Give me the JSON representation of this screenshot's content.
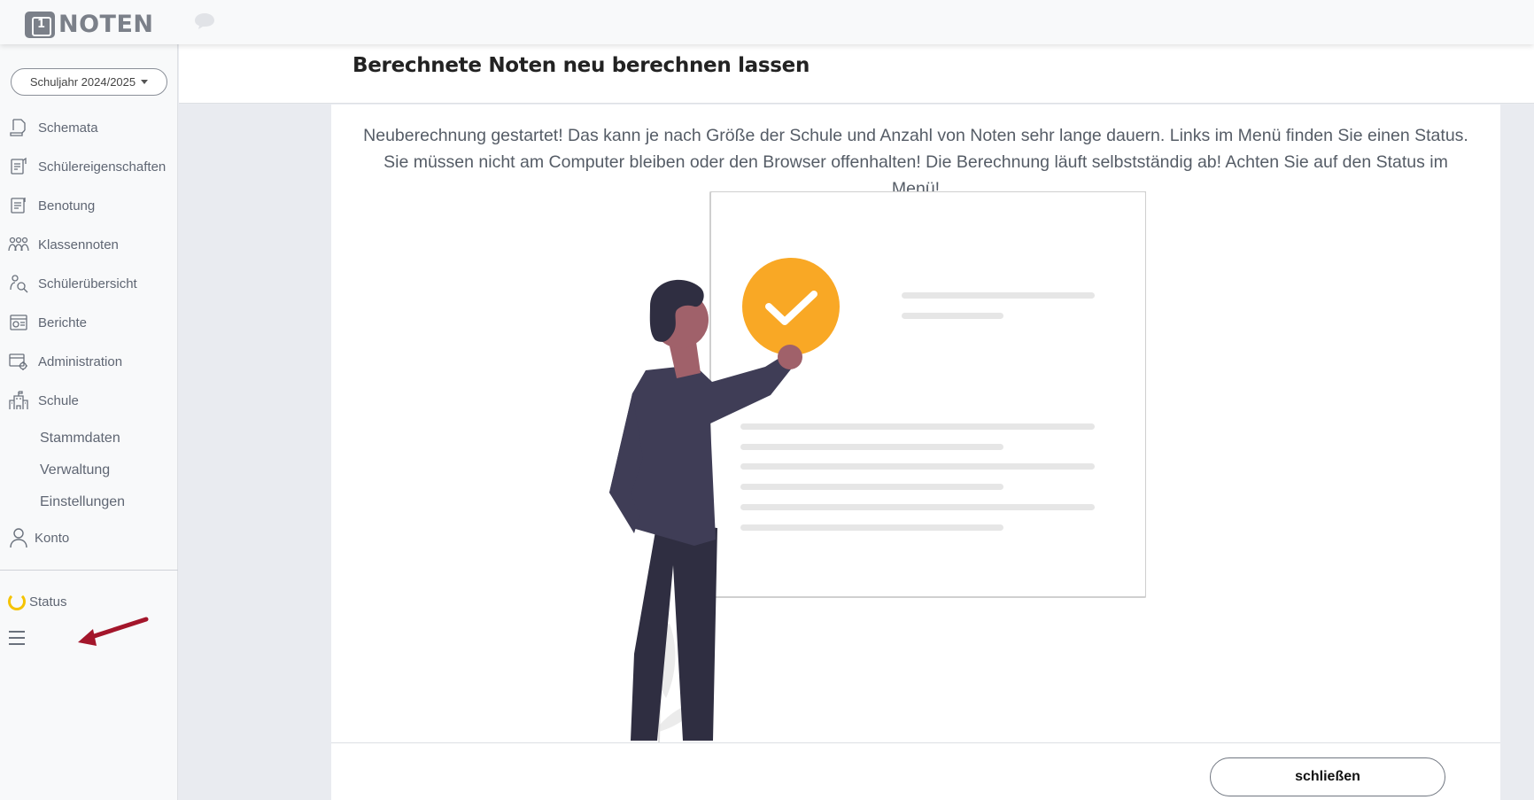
{
  "app": {
    "logo_text": "NOTEN"
  },
  "sidebar": {
    "school_year": "Schuljahr 2024/2025",
    "items": [
      {
        "label": "Schemata",
        "icon": "schema-icon"
      },
      {
        "label": "Schülereigenschaften",
        "icon": "student-properties-icon"
      },
      {
        "label": "Benotung",
        "icon": "grading-icon"
      },
      {
        "label": "Klassennoten",
        "icon": "class-grades-icon"
      },
      {
        "label": "Schülerübersicht",
        "icon": "student-search-icon"
      },
      {
        "label": "Berichte",
        "icon": "reports-icon"
      },
      {
        "label": "Administration",
        "icon": "administration-icon"
      },
      {
        "label": "Schule",
        "icon": "school-icon"
      }
    ],
    "sub_items": [
      {
        "label": "Stammdaten"
      },
      {
        "label": "Verwaltung"
      },
      {
        "label": "Einstellungen"
      }
    ],
    "account": {
      "label": "Konto",
      "icon": "user-icon"
    },
    "status": {
      "label": "Status",
      "icon": "spinner-icon",
      "color": "#f5c300"
    }
  },
  "main": {
    "title": "Berechnete Noten neu berechnen lassen",
    "message": "Neuberechnung gestartet! Das kann je nach Größe der Schule und Anzahl von Noten sehr lange dauern. Links im Menü finden Sie einen Status. Sie müssen nicht am Computer bleiben oder den Browser offenhalten! Die Berechnung läuft selbstständig ab! Achten Sie auf den Status im Menü!",
    "close_label": "schließen"
  },
  "colors": {
    "accent": "#f9a825",
    "arrow": "#a3162b",
    "figure": "#3f3d56"
  }
}
